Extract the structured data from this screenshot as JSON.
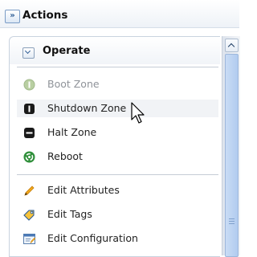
{
  "header": {
    "expand_glyph": "»",
    "title": "Actions"
  },
  "panel": {
    "title": "Operate"
  },
  "items": [
    {
      "label": "Boot Zone",
      "icon": "boot-zone-icon",
      "enabled": false
    },
    {
      "label": "Shutdown Zone",
      "icon": "shutdown-zone-icon",
      "enabled": true,
      "hovered": true
    },
    {
      "label": "Halt Zone",
      "icon": "halt-zone-icon",
      "enabled": true
    },
    {
      "label": "Reboot",
      "icon": "reboot-icon",
      "enabled": true
    },
    {
      "label": "Edit Attributes",
      "icon": "pencil-icon",
      "enabled": true
    },
    {
      "label": "Edit Tags",
      "icon": "tag-icon",
      "enabled": true
    },
    {
      "label": "Edit Configuration",
      "icon": "configuration-icon",
      "enabled": true
    }
  ],
  "colors": {
    "accent": "#2d5c94",
    "disabled_text": "#8f9399",
    "scroll_thumb": "#b1cbef"
  }
}
